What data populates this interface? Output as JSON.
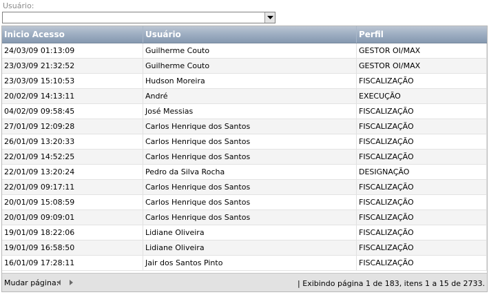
{
  "filter": {
    "label": "Usuário:",
    "selected_value": ""
  },
  "grid": {
    "columns": [
      "Inicio Acesso",
      "Usuário",
      "Perfil"
    ],
    "rows": [
      [
        "24/03/09 01:13:09",
        "Guilherme Couto",
        "GESTOR OI/MAX"
      ],
      [
        "23/03/09 21:32:52",
        "Guilherme Couto",
        "GESTOR OI/MAX"
      ],
      [
        "23/03/09 15:10:53",
        "Hudson Moreira",
        "FISCALIZAÇÃO"
      ],
      [
        "20/02/09 14:13:11",
        "André",
        "EXECUÇÃO"
      ],
      [
        "04/02/09 09:58:45",
        "José Messias",
        "FISCALIZAÇÃO"
      ],
      [
        "27/01/09 12:09:28",
        "Carlos Henrique dos Santos",
        "FISCALIZAÇÃO"
      ],
      [
        "26/01/09 13:20:33",
        "Carlos Henrique dos Santos",
        "FISCALIZAÇÃO"
      ],
      [
        "22/01/09 14:52:25",
        "Carlos Henrique dos Santos",
        "FISCALIZAÇÃO"
      ],
      [
        "22/01/09 13:20:24",
        "Pedro da Silva Rocha",
        "DESIGNAÇÃO"
      ],
      [
        "22/01/09 09:17:11",
        "Carlos Henrique dos Santos",
        "FISCALIZAÇÃO"
      ],
      [
        "20/01/09 15:08:59",
        "Carlos Henrique dos Santos",
        "FISCALIZAÇÃO"
      ],
      [
        "20/01/09 09:09:01",
        "Carlos Henrique dos Santos",
        "FISCALIZAÇÃO"
      ],
      [
        "19/01/09 18:22:06",
        "Lidiane Oliveira",
        "FISCALIZAÇÃO"
      ],
      [
        "19/01/09 16:58:50",
        "Lidiane Oliveira",
        "FISCALIZAÇÃO"
      ],
      [
        "16/01/09 17:28:11",
        "Jair dos Santos Pinto",
        "FISCALIZAÇÃO"
      ]
    ]
  },
  "pager": {
    "label": "Mudar página:",
    "info": "| Exibindo página 1 de 183, itens 1 a 15 de 2733.",
    "prev_icon": "triangle-left-icon",
    "next_icon": "triangle-right-icon"
  },
  "colors": {
    "header_gradient_top": "#bcc6d3",
    "header_gradient_bottom": "#8699b0",
    "pager_bg": "#e2e2e2",
    "row_alt_bg": "#f4f4f4"
  }
}
